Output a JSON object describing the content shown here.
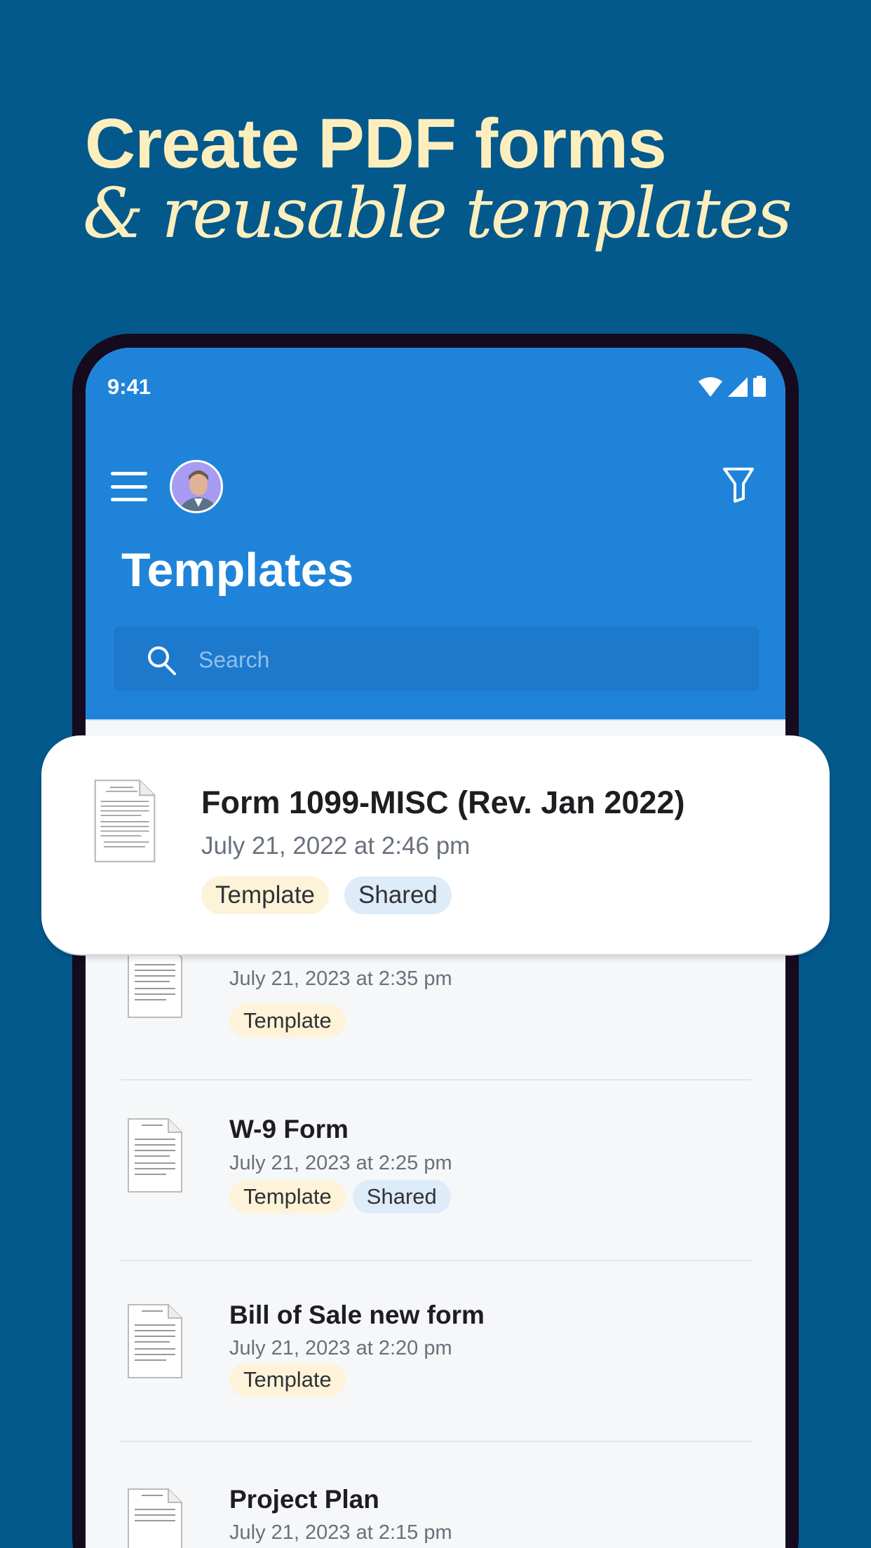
{
  "promo": {
    "headline": "Create PDF forms",
    "subheadline": "& reusable templates"
  },
  "status_bar": {
    "time": "9:41"
  },
  "app_bar": {
    "title": "Templates",
    "search_placeholder": "Search"
  },
  "featured_item": {
    "title": "Form 1099-MISC (Rev. Jan 2022)",
    "date": "July 21, 2022 at 2:46 pm",
    "tags": [
      "Template",
      "Shared"
    ]
  },
  "items": [
    {
      "date": "July 21, 2023 at 2:35 pm",
      "tags": [
        "Template"
      ]
    },
    {
      "title": "W-9 Form",
      "date": "July 21, 2023 at 2:25 pm",
      "tags": [
        "Template",
        "Shared"
      ]
    },
    {
      "title": "Bill of Sale new form",
      "date": "July 21, 2023 at 2:20 pm",
      "tags": [
        "Template"
      ]
    },
    {
      "title": "Project Plan",
      "date": "July 21, 2023 at 2:15 pm",
      "tags": []
    }
  ],
  "colors": {
    "background": "#04598c",
    "headline": "#fdefbd",
    "app_bar": "#1f84d9",
    "tag_template": "#fdf3d8",
    "tag_shared": "#deebf9"
  }
}
